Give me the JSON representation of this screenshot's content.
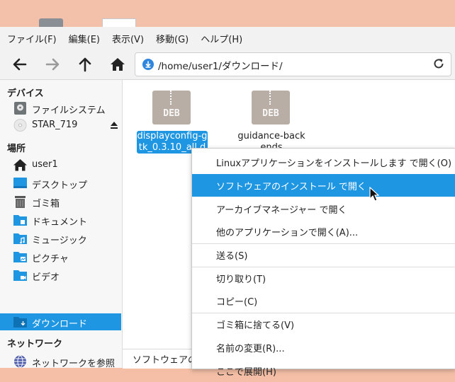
{
  "menubar": [
    "ファイル(F)",
    "編集(E)",
    "表示(V)",
    "移動(G)",
    "ヘルプ(H)"
  ],
  "toolbar": {
    "back_icon": "arrow-left-icon",
    "forward_icon": "arrow-right-icon",
    "up_icon": "arrow-up-icon",
    "home_icon": "home-icon"
  },
  "address": {
    "path": "/home/user1/ダウンロード/"
  },
  "sidebar": {
    "devices_title": "デバイス",
    "devices": [
      {
        "label": "ファイルシステム",
        "icon": "harddisk-icon"
      },
      {
        "label": "STAR_719",
        "icon": "disc-icon"
      }
    ],
    "places_title": "場所",
    "places": [
      {
        "label": "user1",
        "icon": "home-icon"
      },
      {
        "label": "デスクトップ",
        "icon": "desktop-icon"
      },
      {
        "label": "ゴミ箱",
        "icon": "trash-icon"
      },
      {
        "label": "ドキュメント",
        "icon": "folder-documents-icon"
      },
      {
        "label": "ミュージック",
        "icon": "folder-music-icon"
      },
      {
        "label": "ピクチャ",
        "icon": "folder-pictures-icon"
      },
      {
        "label": "ビデオ",
        "icon": "folder-videos-icon"
      },
      {
        "label": "ダウンロード",
        "icon": "folder-download-icon"
      }
    ],
    "network_title": "ネットワーク",
    "network": [
      {
        "label": "ネットワークを参照",
        "icon": "network-icon"
      }
    ]
  },
  "files": [
    {
      "name": "displayconfig-gtk_0.3.10_all.deb",
      "shown": "displayconfig-gtk_0.3.10_all.deb",
      "type_label": "DEB"
    },
    {
      "name": "guidance-backends",
      "shown": "guidance-backends",
      "type_label": "DEB"
    }
  ],
  "status": {
    "text": "ソフトウェアのインストール"
  },
  "context_menu": [
    "Linuxアプリケーションをインストールします で開く(O)",
    "ソフトウェアのインストール で開く",
    "アーカイブマネージャー で開く",
    "他のアプリケーションで開く(A)...",
    "送る(S)",
    "切り取り(T)",
    "コピー(C)",
    "ゴミ箱に捨てる(V)",
    "名前の変更(R)...",
    "ここで展開(H)"
  ],
  "colors": {
    "accent": "#1f96e2",
    "deb_icon": "#b9aea6"
  }
}
